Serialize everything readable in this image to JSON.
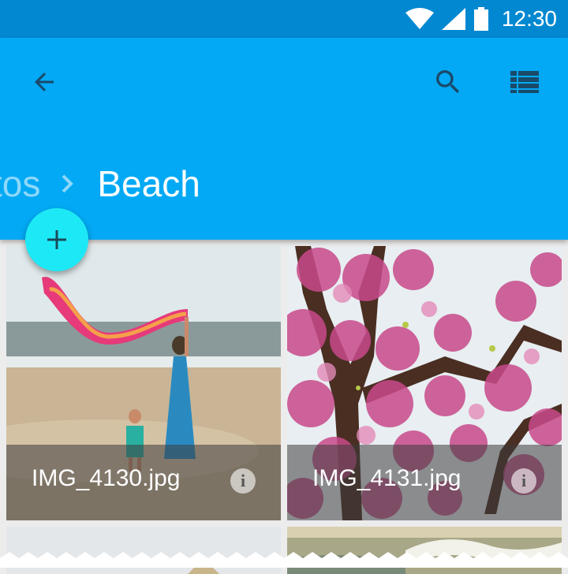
{
  "status_bar": {
    "time": "12:30",
    "icons": [
      "wifi-icon",
      "signal-icon",
      "battery-icon"
    ]
  },
  "app_bar": {
    "color": "#03a9f4",
    "status_color": "#0288d1",
    "icons": [
      "back-arrow-icon",
      "search-icon",
      "list-view-icon"
    ]
  },
  "breadcrumb": {
    "previous": "tos",
    "current": "Beach"
  },
  "fab": {
    "icon": "plus-icon",
    "color": "#1de9f6"
  },
  "photos": [
    {
      "filename": "IMG_4130.jpg",
      "info_icon": "info-icon"
    },
    {
      "filename": "IMG_4131.jpg",
      "info_icon": "info-icon"
    }
  ]
}
